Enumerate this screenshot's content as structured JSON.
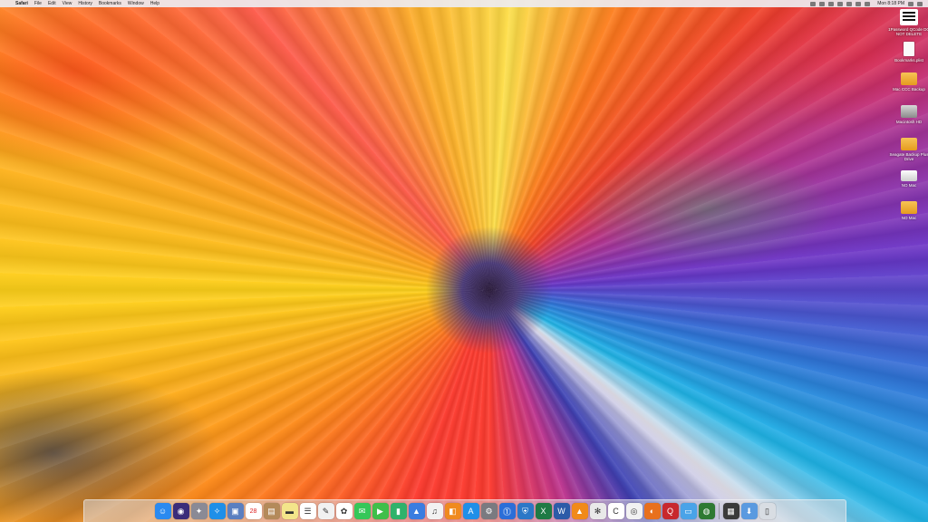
{
  "menubar": {
    "app_name": "Safari",
    "items": [
      "File",
      "Edit",
      "View",
      "History",
      "Bookmarks",
      "Window",
      "Help"
    ],
    "clock": "Mon 8:18 PM"
  },
  "desktop_icons": [
    {
      "label": "1Password QCode DO NOT DELETE",
      "icon": "qr-code-icon",
      "kind": "qr"
    },
    {
      "label": "Bookmarks.plist",
      "icon": "document-icon",
      "kind": "doc"
    },
    {
      "label": "Mac CCC Backup",
      "icon": "external-drive-icon",
      "kind": "drive-orange"
    },
    {
      "label": "Macintosh HD",
      "icon": "hard-drive-icon",
      "kind": "drive-gray"
    },
    {
      "label": "Seagate Backup Plus Drive",
      "icon": "external-drive-icon",
      "kind": "drive-orange"
    },
    {
      "label": "NO Mac",
      "icon": "external-drive-icon",
      "kind": "drive-white"
    },
    {
      "label": "NO Mac",
      "icon": "external-drive-icon",
      "kind": "drive-orange"
    }
  ],
  "dock": {
    "apps": [
      {
        "name": "finder-icon",
        "color": "#2a8af0",
        "glyph": "☺"
      },
      {
        "name": "siri-icon",
        "color": "#3b2d7a",
        "glyph": "◉"
      },
      {
        "name": "launchpad-icon",
        "color": "#8a8a95",
        "glyph": "✦"
      },
      {
        "name": "safari-icon",
        "color": "#1f8fe8",
        "glyph": "✧"
      },
      {
        "name": "preview-icon",
        "color": "#5a7fc0",
        "glyph": "▣"
      },
      {
        "name": "calendar-icon",
        "color": "#ffffff",
        "glyph": "28"
      },
      {
        "name": "contacts-icon",
        "color": "#b48a5a",
        "glyph": "▤"
      },
      {
        "name": "notes-icon",
        "color": "#f3e58a",
        "glyph": "▬"
      },
      {
        "name": "reminders-icon",
        "color": "#ffffff",
        "glyph": "☰"
      },
      {
        "name": "textedit-icon",
        "color": "#f1f1f1",
        "glyph": "✎"
      },
      {
        "name": "photos-icon",
        "color": "#ffffff",
        "glyph": "✿"
      },
      {
        "name": "messages-icon",
        "color": "#35c759",
        "glyph": "✉"
      },
      {
        "name": "facetime-icon",
        "color": "#3fbf4a",
        "glyph": "▶"
      },
      {
        "name": "numbers-icon",
        "color": "#2fb26b",
        "glyph": "▮"
      },
      {
        "name": "keynote-icon",
        "color": "#3a7de0",
        "glyph": "▲"
      },
      {
        "name": "itunes-icon",
        "color": "#f2f2f2",
        "glyph": "♫"
      },
      {
        "name": "ibooks-icon",
        "color": "#f08a1e",
        "glyph": "◧"
      },
      {
        "name": "app-store-icon",
        "color": "#1f8fe8",
        "glyph": "A"
      },
      {
        "name": "system-preferences-icon",
        "color": "#7a7a80",
        "glyph": "⚙"
      },
      {
        "name": "1password-icon",
        "color": "#2c6ed8",
        "glyph": "⓵"
      },
      {
        "name": "shield-icon",
        "color": "#2b77c7",
        "glyph": "⛨"
      },
      {
        "name": "excel-icon",
        "color": "#1e7a45",
        "glyph": "X"
      },
      {
        "name": "word-icon",
        "color": "#2c5ba8",
        "glyph": "W"
      },
      {
        "name": "vlc-icon",
        "color": "#f18a1a",
        "glyph": "▲"
      },
      {
        "name": "pinwheel-icon",
        "color": "#e9e9e9",
        "glyph": "✻"
      },
      {
        "name": "ccleaner-icon",
        "color": "#ffffff",
        "glyph": "C"
      },
      {
        "name": "disk-utility-icon",
        "color": "#f2f2f2",
        "glyph": "◎"
      },
      {
        "name": "firefox-icon",
        "color": "#e8701c",
        "glyph": "◐"
      },
      {
        "name": "quicken-icon",
        "color": "#c8282d",
        "glyph": "Q"
      },
      {
        "name": "folder-icon",
        "color": "#4aa3e8",
        "glyph": "▭"
      },
      {
        "name": "globe-icon",
        "color": "#2e7a32",
        "glyph": "◍"
      },
      {
        "name": "calculator-icon",
        "color": "#3a3a3a",
        "glyph": "▦"
      },
      {
        "name": "downloads-icon",
        "color": "#5a9ae0",
        "glyph": "⬇"
      },
      {
        "name": "trash-icon",
        "color": "#d8dde3",
        "glyph": "▯"
      }
    ]
  }
}
